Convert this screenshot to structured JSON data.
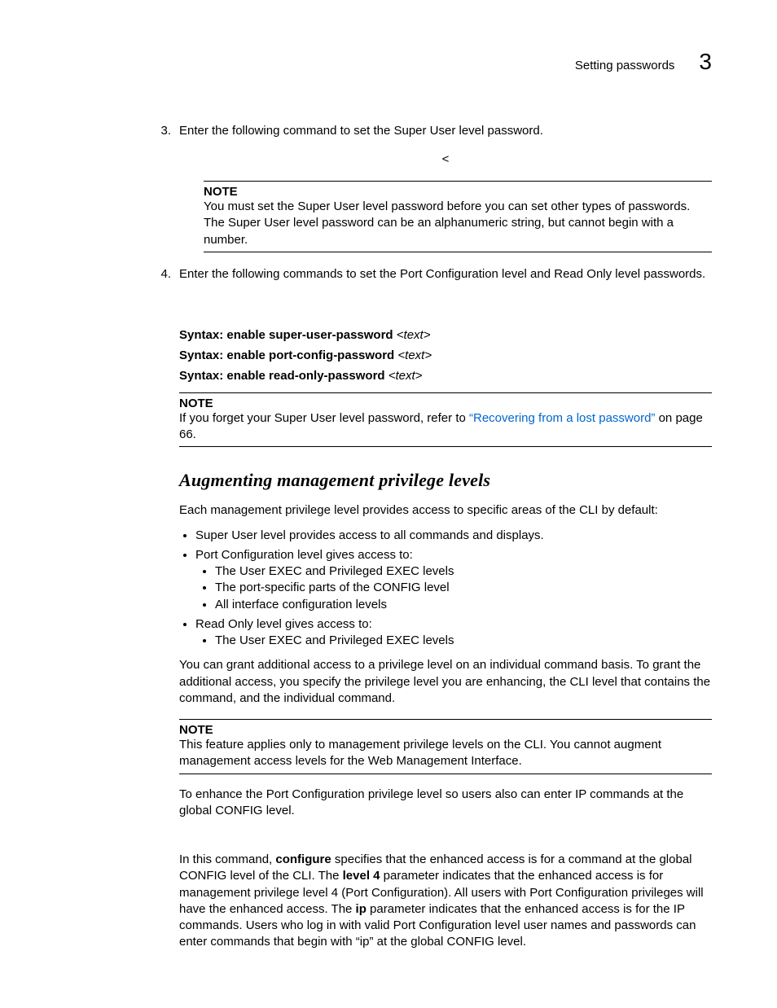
{
  "header": {
    "title": "Setting passwords",
    "chapter": "3"
  },
  "steps": {
    "s3": {
      "num": "3.",
      "text": "Enter the following command to set the Super User level password."
    },
    "lt": "<",
    "s4": {
      "num": "4.",
      "text": "Enter the following commands to set the Port Configuration level and Read Only level passwords."
    }
  },
  "note1": {
    "label": "NOTE",
    "body": "You must set the Super User level password before you can set other types of passwords.  The Super User level password can be an alphanumeric string, but cannot begin with a number."
  },
  "syntax": {
    "label": "Syntax:",
    "lines": [
      {
        "cmd": "enable super-user-password",
        "arg": "<text>"
      },
      {
        "cmd": "enable port-config-password",
        "arg": "<text>"
      },
      {
        "cmd": "enable read-only-password",
        "arg": "<text>"
      }
    ]
  },
  "note2": {
    "label": "NOTE",
    "prefix": "If you forget your Super User level password, refer to ",
    "link": "“Recovering from a lost password”",
    "suffix": " on page 66."
  },
  "subsection": "Augmenting management privilege levels",
  "intro": "Each management privilege level provides access to specific areas of the CLI by default:",
  "bullets": {
    "b1": "Super User level provides access to all commands and displays.",
    "b2": "Port Configuration level gives access to:",
    "b2a": "The User EXEC and Privileged EXEC levels",
    "b2b": "The port-specific parts of the CONFIG level",
    "b2c": "All interface configuration levels",
    "b3": "Read Only level gives access to:",
    "b3a": "The User EXEC and Privileged EXEC levels"
  },
  "para2": "You can grant additional access to a privilege level on an individual command basis.  To grant the additional access, you specify the privilege level you are enhancing, the CLI level that contains the command, and the individual command.",
  "note3": {
    "label": "NOTE",
    "body": "This feature applies only to management privilege levels on the CLI.  You cannot augment management access levels for the Web Management Interface."
  },
  "para3": "To enhance the Port Configuration privilege level so users also can enter IP commands at the global CONFIG level.",
  "para4": {
    "t1": "In this command, ",
    "b1": "configure",
    "t2": " specifies that the enhanced access is for a command at the global CONFIG level of the CLI.  The ",
    "b2": "level 4",
    "t3": " parameter indicates that the enhanced access is for management privilege level 4 (Port Configuration).  All users with Port Configuration privileges will have the enhanced access.  The ",
    "b3": "ip",
    "t4": " parameter indicates that the enhanced access is for the IP commands.  Users who log in with valid Port Configuration level user names and passwords can enter commands that begin with “ip” at the global CONFIG level."
  }
}
